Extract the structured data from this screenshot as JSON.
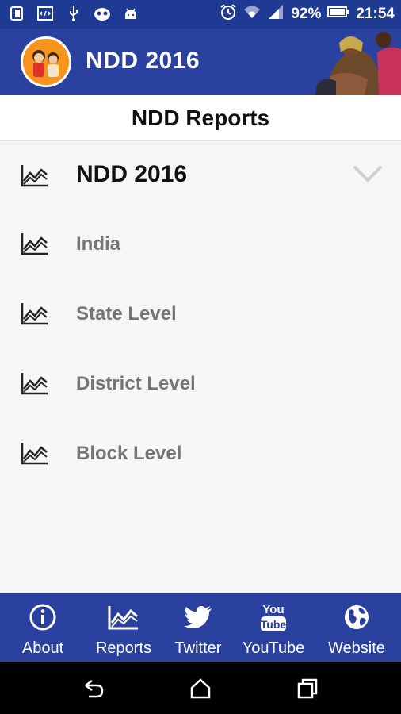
{
  "status_bar": {
    "battery": "92%",
    "time": "21:54",
    "icons": [
      "sim-icon",
      "code-icon",
      "usb-icon",
      "cat-face-icon",
      "android-icon",
      "alarm-icon",
      "wifi-icon",
      "signal-icon",
      "battery-icon"
    ]
  },
  "app_bar": {
    "title": "NDD 2016",
    "logo": "ndd-logo",
    "banner": "mother-child-photo"
  },
  "page": {
    "heading": "NDD Reports"
  },
  "report_group": {
    "title": "NDD 2016",
    "icon": "line-chart-icon",
    "expanded_icon": "chevron-down-icon",
    "items": [
      {
        "label": "India"
      },
      {
        "label": "State Level"
      },
      {
        "label": "District Level"
      },
      {
        "label": "Block Level"
      }
    ]
  },
  "bottom_nav": {
    "items": [
      {
        "label": "About",
        "icon": "info-icon"
      },
      {
        "label": "Reports",
        "icon": "line-chart-icon"
      },
      {
        "label": "Twitter",
        "icon": "twitter-icon"
      },
      {
        "label": "YouTube",
        "icon": "youtube-icon"
      },
      {
        "label": "Website",
        "icon": "globe-icon"
      }
    ]
  },
  "system_nav": {
    "buttons": [
      "back-icon",
      "home-icon",
      "recents-icon"
    ]
  },
  "colors": {
    "primary": "#2a41a0",
    "status_bar": "#1f3a93",
    "logo_orange": "#f7941d",
    "sub_item_text": "#757575"
  }
}
